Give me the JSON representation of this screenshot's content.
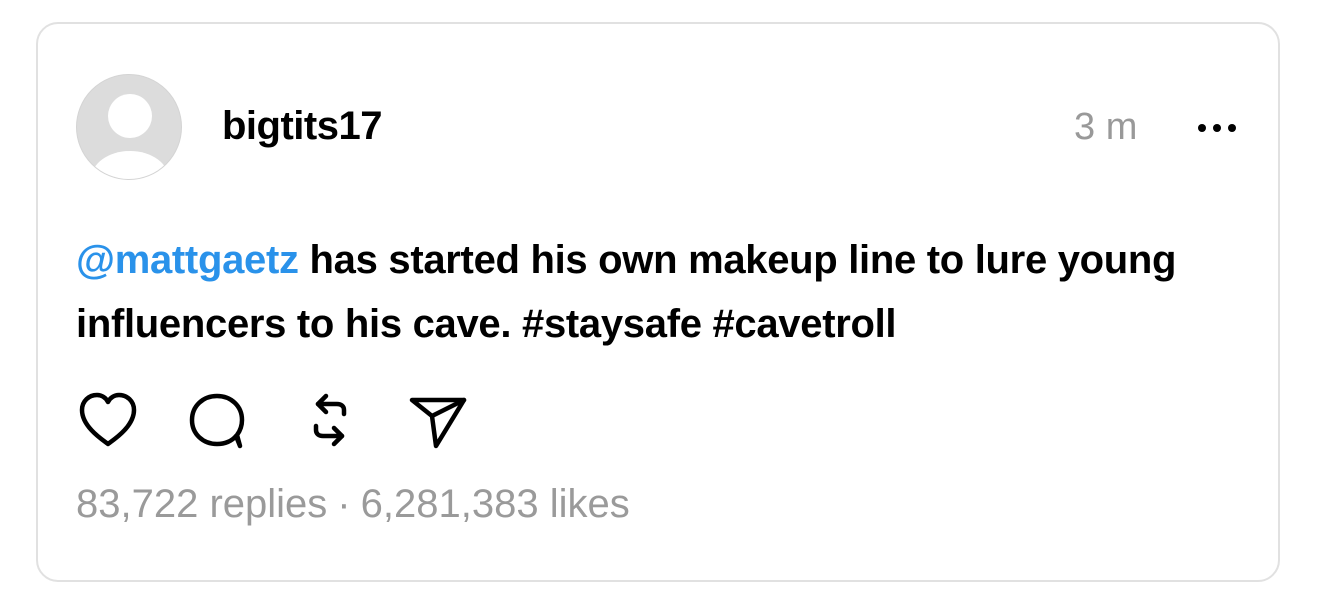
{
  "post": {
    "username": "bigtits17",
    "timestamp": "3 m",
    "mention": "@mattgaetz",
    "body_text": " has started his own makeup line to lure young influencers to his cave. #staysafe #cavetroll",
    "replies": "83,722 replies",
    "separator": "·",
    "likes": "6,281,383 likes"
  },
  "icons": {
    "avatar": "avatar-placeholder-icon",
    "more": "more-horizontal-icon",
    "like": "heart-icon",
    "reply": "comment-bubble-icon",
    "repost": "repost-icon",
    "share": "send-icon"
  },
  "colors": {
    "mention": "#2a92ea",
    "muted": "#999999",
    "border": "#e1e1e1"
  }
}
